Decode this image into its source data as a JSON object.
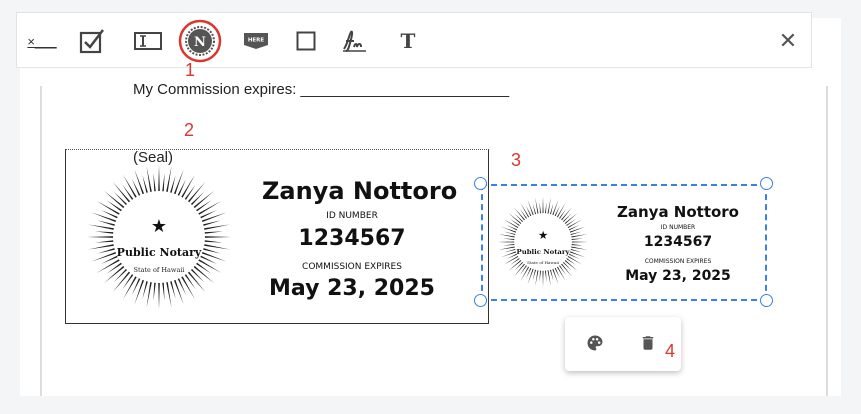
{
  "toolbar": {
    "tools": [
      {
        "name": "text-field-tool",
        "glyph": "×___"
      },
      {
        "name": "checkbox-tool"
      },
      {
        "name": "text-input-tool",
        "glyph": "I"
      },
      {
        "name": "notary-seal-tool",
        "glyph": "N"
      },
      {
        "name": "here-tag-tool",
        "glyph": "HERE"
      },
      {
        "name": "square-tool"
      },
      {
        "name": "signature-tool",
        "glyph": "fn"
      },
      {
        "name": "text-tool",
        "glyph": "T"
      }
    ],
    "close_glyph": "✕"
  },
  "document": {
    "commission_line": "My Commission expires: _________________________",
    "seal_label": "(Seal)"
  },
  "annotations": [
    "1",
    "2",
    "3",
    "4"
  ],
  "seal": {
    "star": "★",
    "center_text": "Public Notary",
    "sub_text": "State of Hawaii",
    "name": "Zanya Nottoro",
    "id_label": "ID NUMBER",
    "id_number": "1234567",
    "expires_label": "COMMISSION EXPIRES",
    "expires_date": "May 23, 2025"
  },
  "popup": {
    "palette_icon": "palette-icon",
    "trash_icon": "trash-icon"
  },
  "colors": {
    "accent_blue": "#3a80e6",
    "annotation_red": "#d9372f"
  }
}
